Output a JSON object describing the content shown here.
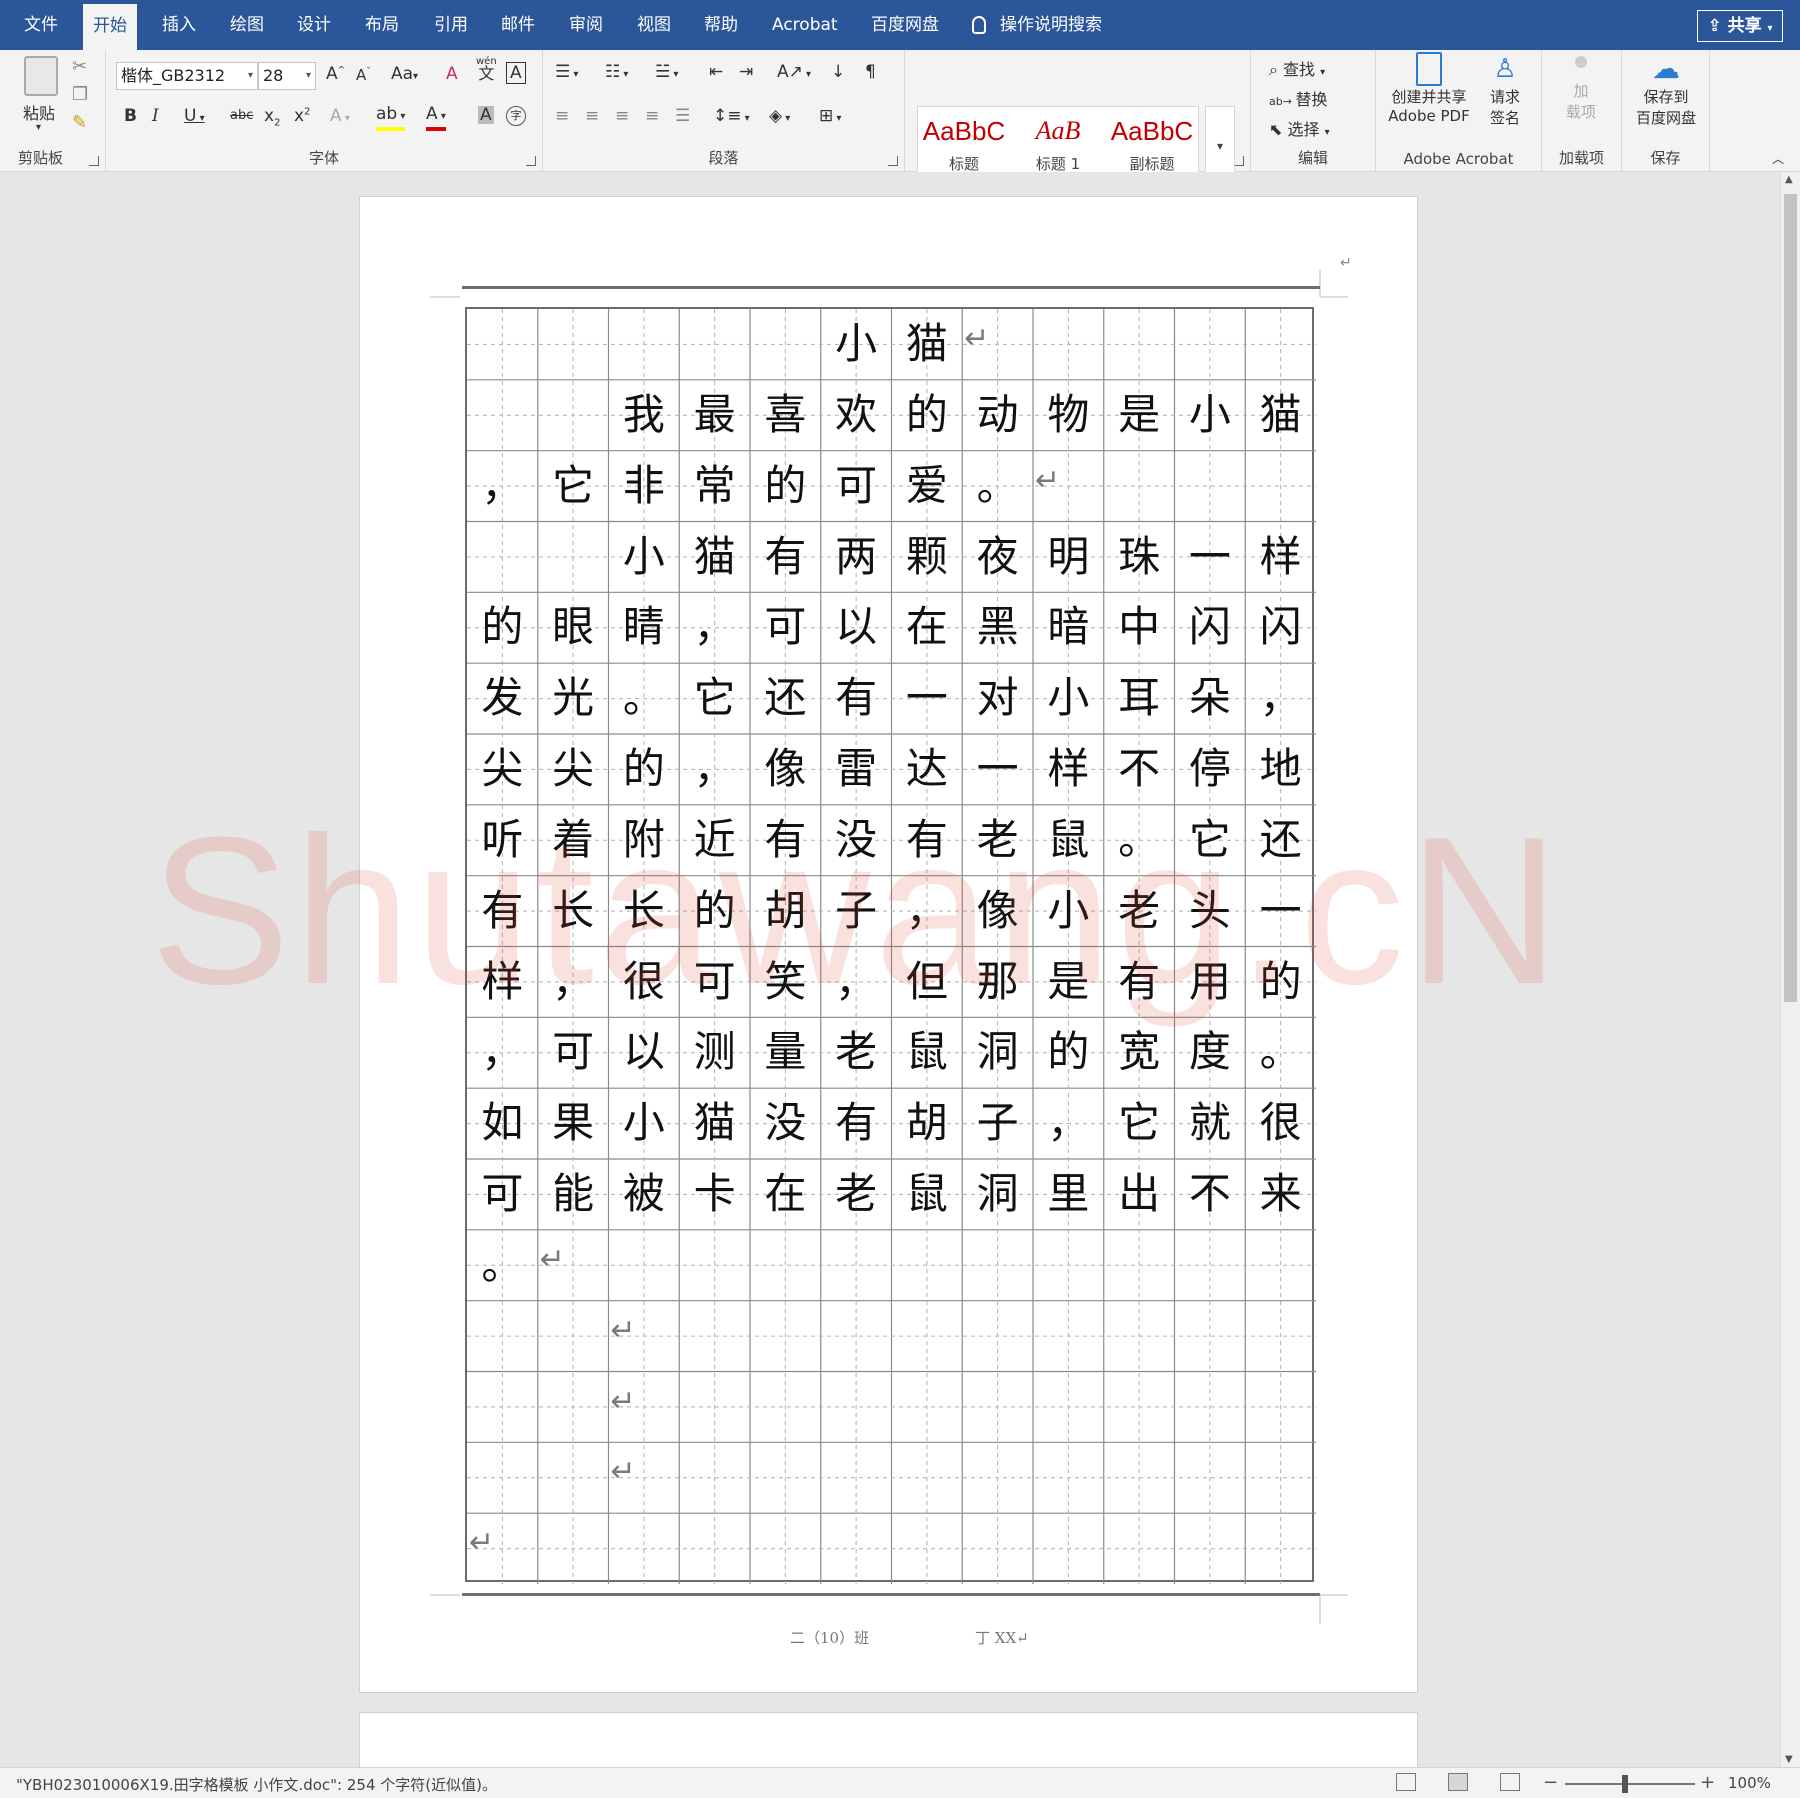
{
  "tabs": [
    {
      "label": "文件"
    },
    {
      "label": "开始"
    },
    {
      "label": "插入"
    },
    {
      "label": "绘图"
    },
    {
      "label": "设计"
    },
    {
      "label": "布局"
    },
    {
      "label": "引用"
    },
    {
      "label": "邮件"
    },
    {
      "label": "审阅"
    },
    {
      "label": "视图"
    },
    {
      "label": "帮助"
    },
    {
      "label": "Acrobat"
    },
    {
      "label": "百度网盘"
    }
  ],
  "active_tab": "开始",
  "tell_me": "操作说明搜索",
  "share_label": "共享",
  "ribbon": {
    "clipboard": {
      "label": "剪贴板",
      "paste": "粘贴"
    },
    "font": {
      "label": "字体",
      "font_name": "楷体_GB2312",
      "font_size": "28",
      "case_btn": "Aa",
      "wen": "wén",
      "wen_char": "文"
    },
    "paragraph": {
      "label": "段落"
    },
    "styles": {
      "label": "样式",
      "items": [
        {
          "preview": "AaBbC",
          "name": "标题"
        },
        {
          "preview": "AaB",
          "name": "标题 1"
        },
        {
          "preview": "AaBbC",
          "name": "副标题"
        }
      ]
    },
    "editing": {
      "label": "编辑",
      "find": "查找",
      "replace": "替换",
      "select": "选择"
    },
    "acrobat": {
      "label": "Adobe Acrobat",
      "create_share": "创建并共享",
      "create_share_sub": "Adobe PDF",
      "request_sign": "请求",
      "request_sign_sub": "签名"
    },
    "addins": {
      "label": "加载项",
      "btn": "加",
      "btn_sub": "载项"
    },
    "save": {
      "label": "保存",
      "btn": "保存到",
      "btn_sub": "百度网盘"
    }
  },
  "document": {
    "grid_cols": 12,
    "grid_rows": 18,
    "rows": [
      [
        "",
        "",
        "",
        "",
        "",
        "小",
        "猫",
        "",
        "",
        "",
        "",
        ""
      ],
      [
        "",
        "",
        "我",
        "最",
        "喜",
        "欢",
        "的",
        "动",
        "物",
        "是",
        "小",
        "猫"
      ],
      [
        "，",
        "它",
        "非",
        "常",
        "的",
        "可",
        "爱",
        "。",
        "",
        "",
        "",
        ""
      ],
      [
        "",
        "",
        "小",
        "猫",
        "有",
        "两",
        "颗",
        "夜",
        "明",
        "珠",
        "一",
        "样"
      ],
      [
        "的",
        "眼",
        "睛",
        "，",
        "可",
        "以",
        "在",
        "黑",
        "暗",
        "中",
        "闪",
        "闪"
      ],
      [
        "发",
        "光",
        "。",
        "它",
        "还",
        "有",
        "一",
        "对",
        "小",
        "耳",
        "朵",
        "，"
      ],
      [
        "尖",
        "尖",
        "的",
        "，",
        "像",
        "雷",
        "达",
        "一",
        "样",
        "不",
        "停",
        "地"
      ],
      [
        "听",
        "着",
        "附",
        "近",
        "有",
        "没",
        "有",
        "老",
        "鼠",
        "。",
        "它",
        "还"
      ],
      [
        "有",
        "长",
        "长",
        "的",
        "胡",
        "子",
        "，",
        "像",
        "小",
        "老",
        "头",
        "一"
      ],
      [
        "样",
        "，",
        "很",
        "可",
        "笑",
        "，",
        "但",
        "那",
        "是",
        "有",
        "用",
        "的"
      ],
      [
        "，",
        "可",
        "以",
        "测",
        "量",
        "老",
        "鼠",
        "洞",
        "的",
        "宽",
        "度",
        "。"
      ],
      [
        "如",
        "果",
        "小",
        "猫",
        "没",
        "有",
        "胡",
        "子",
        "，",
        "它",
        "就",
        "很"
      ],
      [
        "可",
        "能",
        "被",
        "卡",
        "在",
        "老",
        "鼠",
        "洞",
        "里",
        "出",
        "不",
        "来"
      ],
      [
        "。",
        "",
        "",
        "",
        "",
        "",
        "",
        "",
        "",
        "",
        "",
        ""
      ],
      [
        "",
        "",
        "",
        "",
        "",
        "",
        "",
        "",
        "",
        "",
        "",
        ""
      ],
      [
        "",
        "",
        "",
        "",
        "",
        "",
        "",
        "",
        "",
        "",
        "",
        ""
      ],
      [
        "",
        "",
        "",
        "",
        "",
        "",
        "",
        "",
        "",
        "",
        "",
        ""
      ],
      [
        "",
        "",
        "",
        "",
        "",
        "",
        "",
        "",
        "",
        "",
        "",
        ""
      ]
    ],
    "para_mark": "↵",
    "footer_class": "二（10）班",
    "footer_name": "丁 XX↵",
    "header_mark": "↵"
  },
  "watermark": "Shutawang.cN",
  "status": {
    "text": "\"YBH023010006X19.田字格模板 小作文.doc\": 254 个字符(近似值)。",
    "zoom": "100%",
    "zoom_percent": 100
  }
}
